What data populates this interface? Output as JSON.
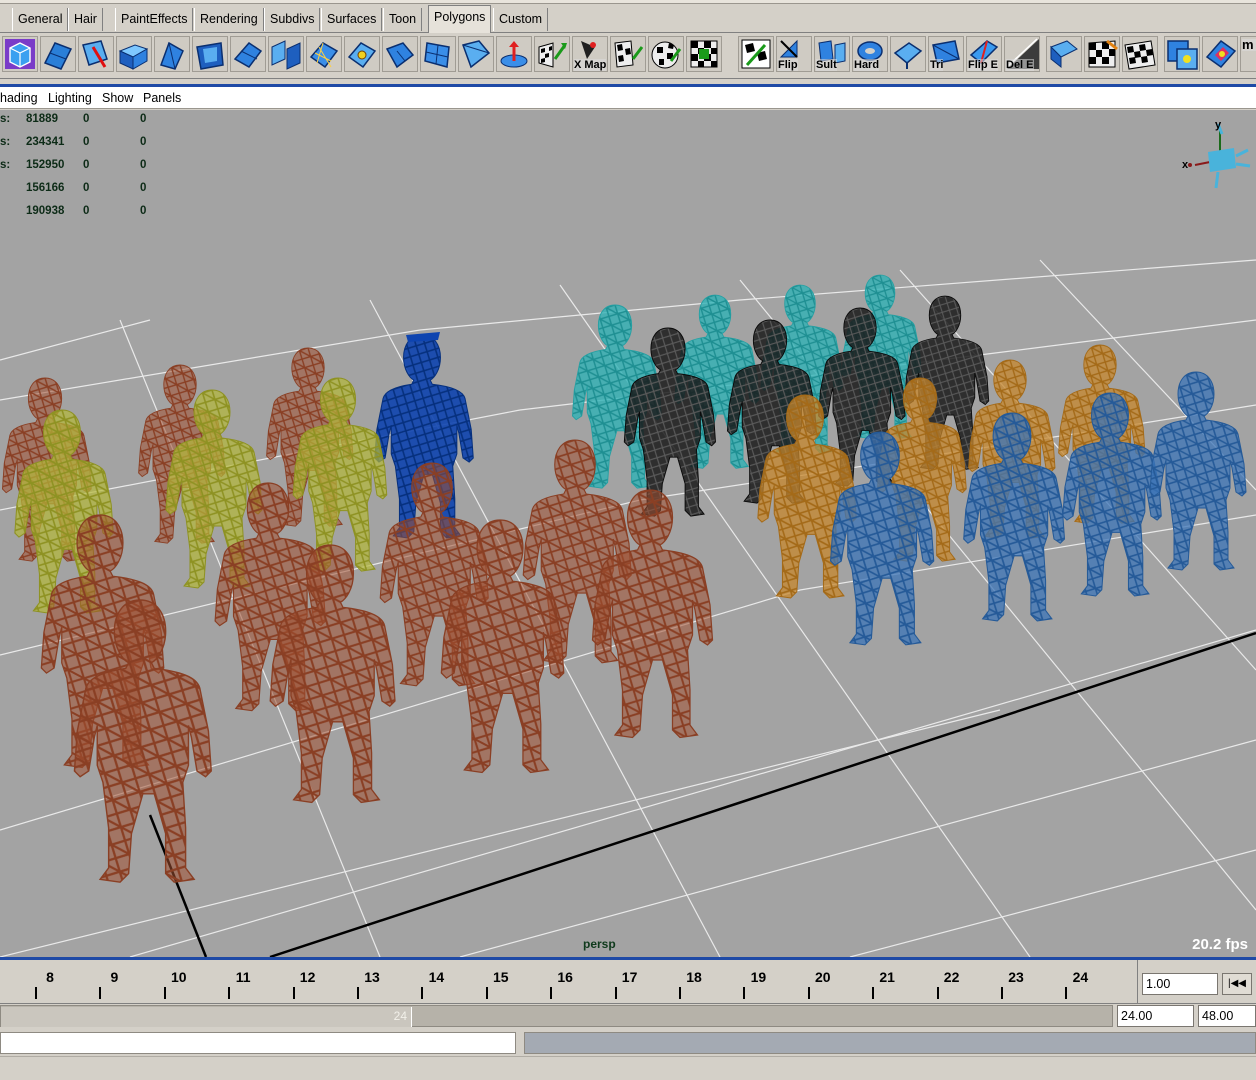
{
  "shelf": {
    "tabs": [
      "General",
      "Hair",
      "PaintEffects",
      "Rendering",
      "Subdivs",
      "Surfaces",
      "Toon",
      "Polygons",
      "Custom"
    ],
    "active_tab": "Polygons",
    "button_labels": [
      "X Map",
      "Flip",
      "Sult",
      "Hard",
      "Tri",
      "Flip E",
      "Del E",
      "m P"
    ]
  },
  "panel_menu": {
    "items": [
      "hading",
      "Lighting",
      "Show",
      "Panels"
    ]
  },
  "hud": {
    "labels": [
      "s:",
      "s:",
      "s:"
    ],
    "rows": [
      [
        "81889",
        "0",
        "0"
      ],
      [
        "234341",
        "0",
        "0"
      ],
      [
        "152950",
        "0",
        "0"
      ],
      [
        "156166",
        "0",
        "0"
      ],
      [
        "190938",
        "0",
        "0"
      ]
    ]
  },
  "viewport": {
    "camera": "persp",
    "fps": "20.2 fps",
    "axis_labels": {
      "x": "x",
      "y": "y"
    },
    "background_color": "#a3a3a3",
    "figure_colors": {
      "rust": "#a04e30",
      "yellow": "#a6aa2a",
      "blue_dark": "#0e44b0",
      "teal": "#28a9ad",
      "black": "#151515",
      "orange": "#c6862c",
      "steel_blue": "#3670b5"
    }
  },
  "timeline": {
    "frames": [
      "8",
      "9",
      "10",
      "11",
      "12",
      "13",
      "14",
      "15",
      "16",
      "17",
      "18",
      "19",
      "20",
      "21",
      "22",
      "23",
      "24"
    ],
    "current_time": "1.00",
    "goto_start_icon": "goto-start-icon"
  },
  "range": {
    "handle_value": "24",
    "handle_fraction": 0.37,
    "range_end": "24.00",
    "playback_end": "48.00"
  },
  "accent_color": "#1f4aa6"
}
